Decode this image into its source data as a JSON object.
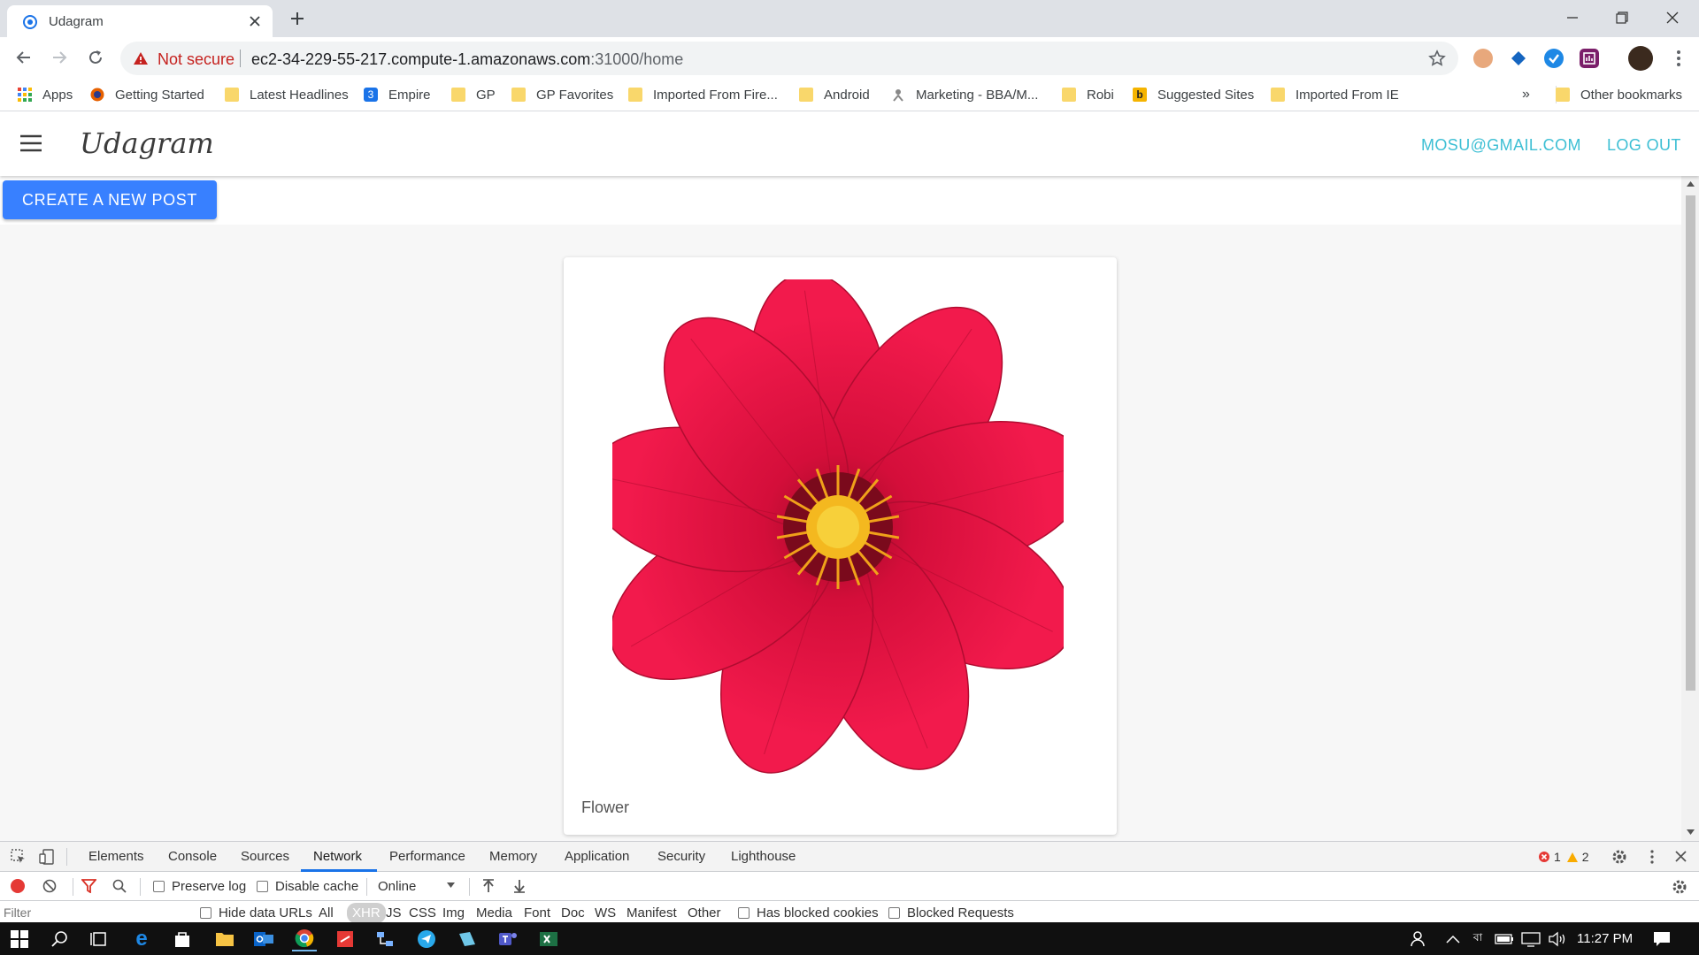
{
  "browser": {
    "tab_title": "Udagram",
    "security_label": "Not secure",
    "url_host": "ec2-34-229-55-217.compute-1.amazonaws.com",
    "url_path": ":31000/home"
  },
  "bookmarks": [
    {
      "label": "Apps",
      "icon": "apps-grid-icon"
    },
    {
      "label": "Getting Started",
      "icon": "firefox-icon"
    },
    {
      "label": "Latest Headlines",
      "icon": "folder-icon"
    },
    {
      "label": "Empire",
      "icon": "empire-icon"
    },
    {
      "label": "GP",
      "icon": "folder-icon"
    },
    {
      "label": "GP Favorites",
      "icon": "folder-icon"
    },
    {
      "label": "Imported From Fire...",
      "icon": "folder-icon"
    },
    {
      "label": "Android",
      "icon": "folder-icon"
    },
    {
      "label": "Marketing - BBA/M...",
      "icon": "site-icon"
    },
    {
      "label": "Robi",
      "icon": "folder-icon"
    },
    {
      "label": "Suggested Sites",
      "icon": "bing-icon"
    },
    {
      "label": "Imported From IE",
      "icon": "folder-icon"
    }
  ],
  "bookmarks_overflow": "»",
  "other_bookmarks": "Other bookmarks",
  "app": {
    "brand": "Udagram",
    "user_email": "MOSU@GMAIL.COM",
    "logout_label": "LOG OUT",
    "create_post_label": "CREATE A NEW POST",
    "posts": [
      {
        "caption": "Flower",
        "image": "red-flower-image"
      }
    ]
  },
  "devtools": {
    "tabs": [
      "Elements",
      "Console",
      "Sources",
      "Network",
      "Performance",
      "Memory",
      "Application",
      "Security",
      "Lighthouse"
    ],
    "active_tab": "Network",
    "error_count": "1",
    "warning_count": "2",
    "preserve_log": "Preserve log",
    "disable_cache": "Disable cache",
    "throttle": "Online",
    "filter_placeholder": "Filter",
    "hide_data_urls": "Hide data URLs",
    "types": [
      "All",
      "XHR",
      "JS",
      "CSS",
      "Img",
      "Media",
      "Font",
      "Doc",
      "WS",
      "Manifest",
      "Other"
    ],
    "has_blocked_cookies": "Has blocked cookies",
    "blocked_requests": "Blocked Requests"
  },
  "taskbar": {
    "clock": "11:27 PM"
  },
  "colors": {
    "accent": "#3880ff",
    "link": "#3dbfd4",
    "flower": "#e0123f"
  }
}
